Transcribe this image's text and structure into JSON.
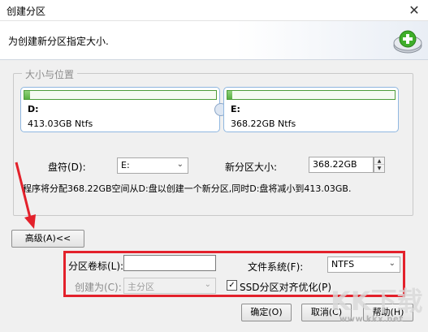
{
  "window": {
    "title": "创建分区",
    "close_glyph": "✕",
    "header_text": "为创建新分区指定大小."
  },
  "group": {
    "legend": "大小与位置"
  },
  "partitions": [
    {
      "name": "D:",
      "info": "413.03GB Ntfs",
      "fill": 0.03
    },
    {
      "name": "E:",
      "info": "368.22GB Ntfs",
      "fill": 0.03
    }
  ],
  "drive_letter": {
    "label": "盘符(D):",
    "value": "E:",
    "arrow": "⌄"
  },
  "new_size": {
    "label": "新分区大小:",
    "value": "368.22GB",
    "up": "▲",
    "down": "▼"
  },
  "info_text": "程序将分配368.22GB空间从D:盘以创建一个新分区,同时D:盘将减小到413.03GB.",
  "advanced_button": "高级(A)<<",
  "advanced": {
    "volume_label": {
      "label": "分区卷标(L):",
      "value": ""
    },
    "filesystem": {
      "label": "文件系统(F):",
      "value": "NTFS",
      "arrow": "⌄"
    },
    "create_as": {
      "label": "创建为(C):",
      "value": "主分区",
      "arrow": "⌄"
    },
    "ssd_align": {
      "label": "SSD分区对齐优化(P)",
      "checked": true,
      "check_glyph": "✓"
    }
  },
  "buttons": {
    "ok": "确定(O)",
    "cancel": "取消(C)",
    "help": "帮助(H)"
  },
  "watermark": {
    "domain": "www.kkx.net"
  },
  "colors": {
    "highlight_box": "#e3212b",
    "partition_border": "#8fb7e0",
    "bar_fill": "#5ab043"
  }
}
